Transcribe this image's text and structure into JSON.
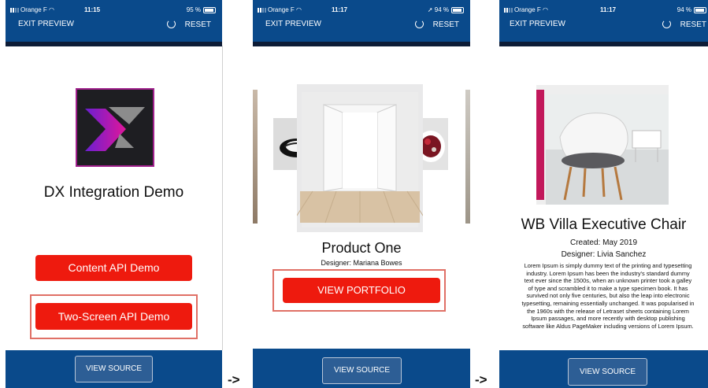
{
  "status": {
    "screen1": {
      "carrier": "Orange F",
      "time": "11:15",
      "battery": "95 %"
    },
    "screen2": {
      "carrier": "Orange F",
      "time": "11:17",
      "battery": "94 %"
    },
    "screen3": {
      "carrier": "Orange F",
      "time": "11:17",
      "battery": "94 %"
    }
  },
  "topbar": {
    "exit_label": "EXIT PREVIEW",
    "reset_label": "RESET"
  },
  "screen1": {
    "app_title": "DX Integration Demo",
    "content_api_button": "Content API Demo",
    "two_screen_button": "Two-Screen API Demo",
    "view_source": "VIEW SOURCE"
  },
  "screen2": {
    "product_title": "Product One",
    "designer": "Designer: Mariana Bowes",
    "portfolio_button": "VIEW PORTFOLIO",
    "view_source": "VIEW SOURCE"
  },
  "screen3": {
    "title": "WB Villa Executive Chair",
    "created": "Created: May 2019",
    "designer": "Designer:  Livia Sanchez",
    "description": "Lorem Ipsum is simply dummy text of the printing and typesetting industry. Lorem Ipsum has been the industry's standard dummy text ever since the 1500s, when an unknown printer took a galley of type and scrambled it to make a type specimen book. It has survived not only five centuries, but also the leap into electronic typesetting, remaining essentially unchanged. It was popularised in the 1960s with the release of Letraset sheets containing Lorem Ipsum passages, and more recently with desktop publishing software like Aldus PageMaker including versions of Lorem Ipsum.",
    "view_source": "VIEW SOURCE"
  },
  "arrow_label": "->",
  "colors": {
    "header": "#0a4a8b",
    "accent_red": "#ee1a0e",
    "highlight": "#e07066",
    "logo_bg": "#1e1e22",
    "logo_border": "#a0208c"
  },
  "icons": [
    "signal-icon",
    "wifi-icon",
    "battery-icon",
    "reset-icon",
    "dx-logo-icon"
  ]
}
